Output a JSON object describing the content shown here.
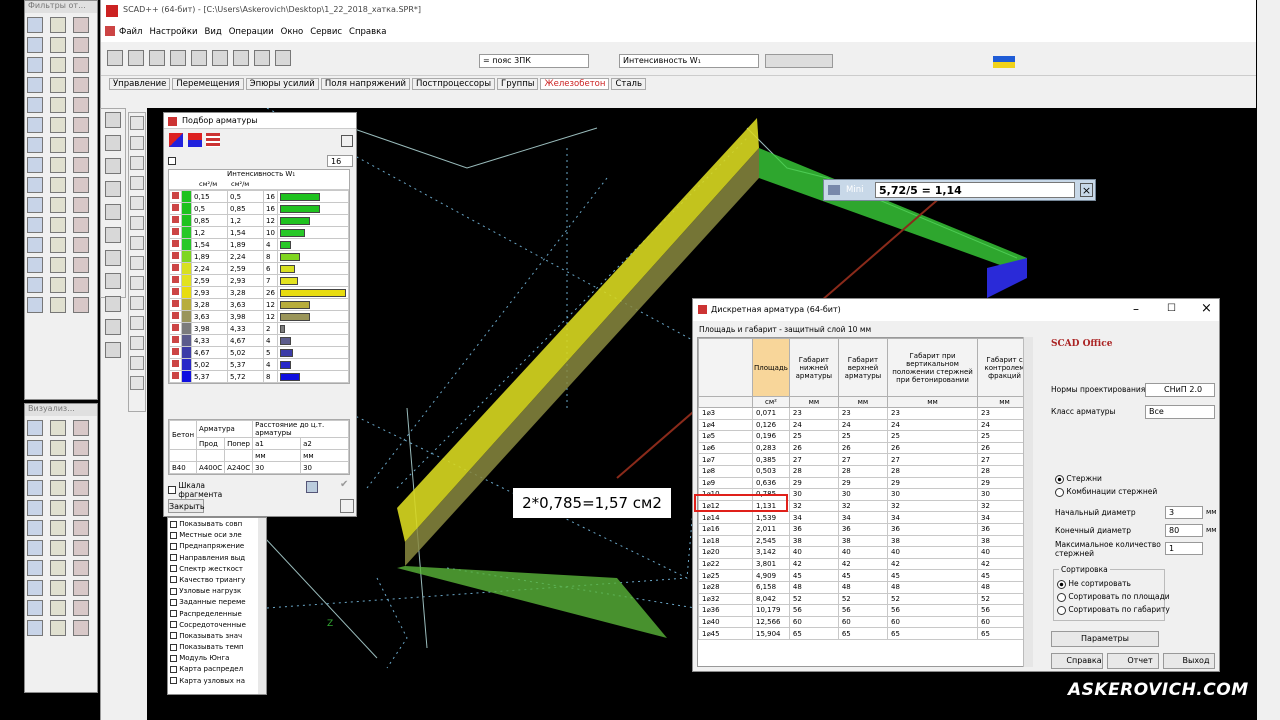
{
  "left_panel": {
    "filters_title": "Фильтры от...",
    "viz_title": "Визуализ..."
  },
  "main_window": {
    "title": "SCAD++ (64-бит) - [C:\\Users\\Askerovich\\Desktop\\1_22_2018_хатка.SPR*]"
  },
  "menu": [
    "Файл",
    "Настройки",
    "Вид",
    "Операции",
    "Окно",
    "Сервис",
    "Справка"
  ],
  "toolbar": {
    "combo_belt": "= пояс 3ПК",
    "combo_intensity": "Интенсивность W₁"
  },
  "tabs": [
    "Управление",
    "Перемещения",
    "Эпюры усилий",
    "Поля напряжений",
    "Постпроцессоры",
    "Группы",
    "Железобетон",
    "Сталь"
  ],
  "active_tab": "Железобетон",
  "reinf_panel": {
    "title": "Подбор арматуры",
    "spin_value": "16",
    "header": "Интенсивность W₁",
    "units": [
      "см²/м",
      "см²/м"
    ],
    "rows": [
      {
        "from": "0,15",
        "to": "0,5",
        "count": "16",
        "color": "#1fc21f",
        "bar": 0.6
      },
      {
        "from": "0,5",
        "to": "0,85",
        "count": "16",
        "color": "#1fc21f",
        "bar": 0.6
      },
      {
        "from": "0,85",
        "to": "1,2",
        "count": "12",
        "color": "#1fc21f",
        "bar": 0.45
      },
      {
        "from": "1,2",
        "to": "1,54",
        "count": "10",
        "color": "#28c828",
        "bar": 0.38
      },
      {
        "from": "1,54",
        "to": "1,89",
        "count": "4",
        "color": "#28c828",
        "bar": 0.16
      },
      {
        "from": "1,89",
        "to": "2,24",
        "count": "8",
        "color": "#7fd620",
        "bar": 0.3
      },
      {
        "from": "2,24",
        "to": "2,59",
        "count": "6",
        "color": "#d8e020",
        "bar": 0.23
      },
      {
        "from": "2,59",
        "to": "2,93",
        "count": "7",
        "color": "#e2e220",
        "bar": 0.27
      },
      {
        "from": "2,93",
        "to": "3,28",
        "count": "26",
        "color": "#e8dc10",
        "bar": 1.0
      },
      {
        "from": "3,28",
        "to": "3,63",
        "count": "12",
        "color": "#b8ad3c",
        "bar": 0.45
      },
      {
        "from": "3,63",
        "to": "3,98",
        "count": "12",
        "color": "#9a955a",
        "bar": 0.45
      },
      {
        "from": "3,98",
        "to": "4,33",
        "count": "2",
        "color": "#7c7c7c",
        "bar": 0.08
      },
      {
        "from": "4,33",
        "to": "4,67",
        "count": "4",
        "color": "#5c5c8c",
        "bar": 0.16
      },
      {
        "from": "4,67",
        "to": "5,02",
        "count": "5",
        "color": "#3c3ca8",
        "bar": 0.2
      },
      {
        "from": "5,02",
        "to": "5,37",
        "count": "4",
        "color": "#2828c8",
        "bar": 0.16
      },
      {
        "from": "5,37",
        "to": "5,72",
        "count": "8",
        "color": "#1010e0",
        "bar": 0.3
      }
    ],
    "info": {
      "col_beton": "Бетон",
      "col_armatura": "Арматура",
      "col_dist": "Расстояние до ц.т. арматуры",
      "prod": "Прод",
      "poper": "Попер",
      "a1": "a1",
      "a2": "a2",
      "mm1": "мм",
      "mm2": "мм",
      "beton": "B40",
      "arm_prod": "A400C",
      "arm_poper": "A240C",
      "v1": "30",
      "v2": "30"
    },
    "scale_label": "Шкала фрагмента",
    "close_btn": "Закрыть"
  },
  "tree_items": [
    "Показывать совп",
    "Местные оси эле",
    "Преднапряжение",
    "Направления выд",
    "Спектр жесткост",
    "Качество триангу",
    "Узловые нагрузк",
    "Заданные переме",
    "Распределенные",
    "Сосредоточенные",
    "Показывать знач",
    "Показывать темп",
    "Модуль Юнга",
    "Карта распредел",
    "Карта узловых на"
  ],
  "mini_calc": {
    "label": "Mini",
    "expr": "5,72/5 = 1,14"
  },
  "annotation": "2*0,785=1,57 см2",
  "discrete": {
    "title": "Дискретная арматура (64-бит)",
    "subtitle": "Площадь и габарит - защитный слой 10 мм",
    "headers": [
      "Площадь",
      "Габарит нижней арматуры",
      "Габарит верхней арматуры",
      "Габарит при вертикальном положении стержней при бетонировании",
      "Габарит с контролем фракций"
    ],
    "units": [
      "см²",
      "мм",
      "мм",
      "мм",
      "мм"
    ],
    "rows": [
      [
        "1⌀3",
        "0,071",
        "23",
        "23",
        "23",
        "23"
      ],
      [
        "1⌀4",
        "0,126",
        "24",
        "24",
        "24",
        "24"
      ],
      [
        "1⌀5",
        "0,196",
        "25",
        "25",
        "25",
        "25"
      ],
      [
        "1⌀6",
        "0,283",
        "26",
        "26",
        "26",
        "26"
      ],
      [
        "1⌀7",
        "0,385",
        "27",
        "27",
        "27",
        "27"
      ],
      [
        "1⌀8",
        "0,503",
        "28",
        "28",
        "28",
        "28"
      ],
      [
        "1⌀9",
        "0,636",
        "29",
        "29",
        "29",
        "29"
      ],
      [
        "1⌀10",
        "0,785",
        "30",
        "30",
        "30",
        "30"
      ],
      [
        "1⌀12",
        "1,131",
        "32",
        "32",
        "32",
        "32"
      ],
      [
        "1⌀14",
        "1,539",
        "34",
        "34",
        "34",
        "34"
      ],
      [
        "1⌀16",
        "2,011",
        "36",
        "36",
        "36",
        "36"
      ],
      [
        "1⌀18",
        "2,545",
        "38",
        "38",
        "38",
        "38"
      ],
      [
        "1⌀20",
        "3,142",
        "40",
        "40",
        "40",
        "40"
      ],
      [
        "1⌀22",
        "3,801",
        "42",
        "42",
        "42",
        "42"
      ],
      [
        "1⌀25",
        "4,909",
        "45",
        "45",
        "45",
        "45"
      ],
      [
        "1⌀28",
        "6,158",
        "48",
        "48",
        "48",
        "48"
      ],
      [
        "1⌀32",
        "8,042",
        "52",
        "52",
        "52",
        "52"
      ],
      [
        "1⌀36",
        "10,179",
        "56",
        "56",
        "56",
        "56"
      ],
      [
        "1⌀40",
        "12,566",
        "60",
        "60",
        "60",
        "60"
      ],
      [
        "1⌀45",
        "15,904",
        "65",
        "65",
        "65",
        "65"
      ]
    ],
    "norms_label": "Нормы проектирования",
    "norms_value": "СНиП 2.0",
    "class_label": "Класс арматуры",
    "class_value": "Все",
    "radio_bars": "Стержни",
    "radio_combo": "Комбинации стержней",
    "start_d_label": "Начальный диаметр",
    "start_d": "3",
    "end_d_label": "Конечный диаметр",
    "end_d": "80",
    "max_count_label": "Максимальное количество стержней",
    "max_count": "1",
    "mm": "мм",
    "sort_title": "Сортировка",
    "sort_none": "Не сортировать",
    "sort_area": "Сортировать по площади",
    "sort_size": "Сортировать по габариту",
    "params_btn": "Параметры",
    "help_btn": "Справка",
    "report_btn": "Отчет",
    "exit_btn": "Выход",
    "logo_text": "SCAD Office"
  },
  "watermark": "Askerovich.com"
}
